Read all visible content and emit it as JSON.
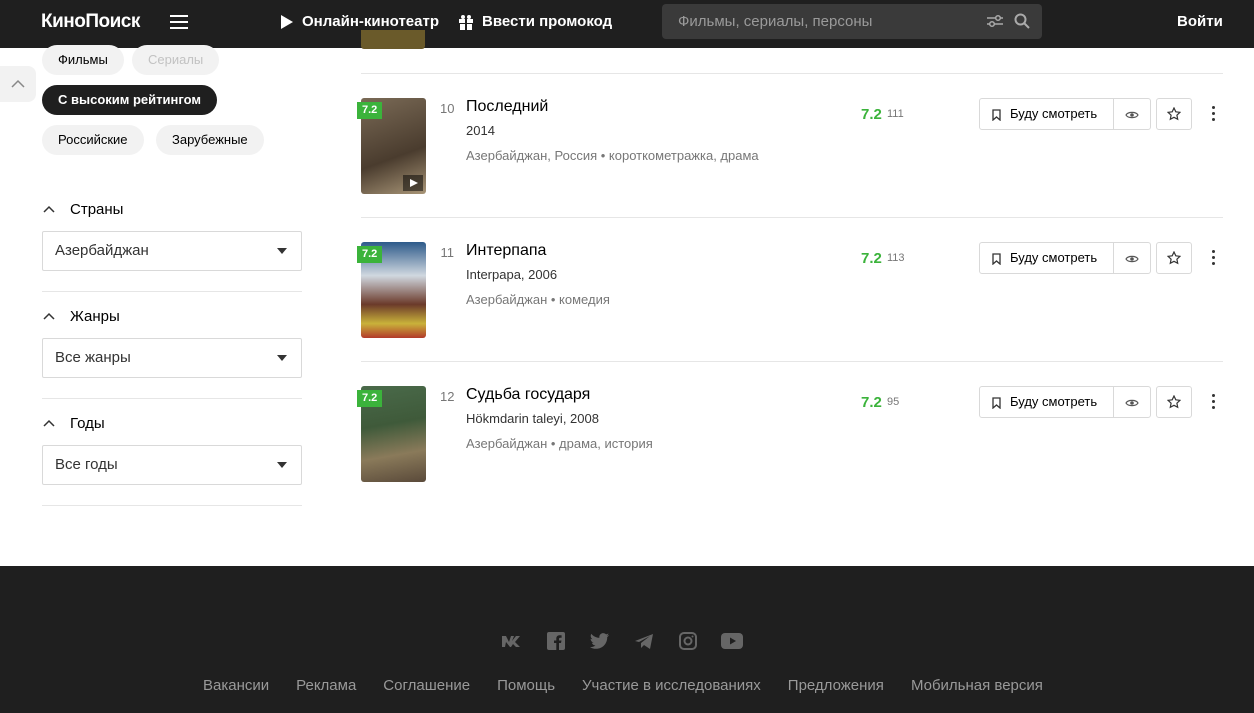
{
  "header": {
    "logo": "КиноПоиск",
    "online_cinema": "Онлайн-кинотеатр",
    "promo": "Ввести промокод",
    "search_placeholder": "Фильмы, сериалы, персоны",
    "login": "Войти"
  },
  "sidebar": {
    "chips": [
      "Фильмы",
      "Сериалы",
      "С высоким рейтингом",
      "Российские",
      "Зарубежные"
    ],
    "countries": {
      "title": "Страны",
      "value": "Азербайджан"
    },
    "genres": {
      "title": "Жанры",
      "value": "Все жанры"
    },
    "years": {
      "title": "Годы",
      "value": "Все годы"
    }
  },
  "items": [
    {
      "position": "10",
      "badge": "7.2",
      "title": "Последний",
      "subtitle": "2014",
      "meta": "Азербайджан, Россия • короткометражка, драма",
      "rating": "7.2",
      "votes": "111",
      "watch_label": "Буду смотреть",
      "poster_colors": [
        "#6b5a48",
        "#a89577"
      ]
    },
    {
      "position": "11",
      "badge": "7.2",
      "title": "Интерпапа",
      "subtitle": "Interpapa, 2006",
      "meta": "Азербайджан • комедия",
      "rating": "7.2",
      "votes": "113",
      "watch_label": "Буду смотреть",
      "poster_colors": [
        "#2d5a8a",
        "#c9b23a"
      ]
    },
    {
      "position": "12",
      "badge": "7.2",
      "title": "Судьба государя",
      "subtitle": "Hökmdarin taleyi, 2008",
      "meta": "Азербайджан • драма, история",
      "rating": "7.2",
      "votes": "95",
      "watch_label": "Буду смотреть",
      "poster_colors": [
        "#3f5a3a",
        "#8a7a5a"
      ]
    }
  ],
  "footer": {
    "social": [
      "vk-icon",
      "facebook-icon",
      "twitter-icon",
      "telegram-icon",
      "instagram-icon",
      "youtube-icon"
    ],
    "links": [
      "Вакансии",
      "Реклама",
      "Соглашение",
      "Помощь",
      "Участие в исследованиях",
      "Предложения",
      "Мобильная версия"
    ]
  },
  "colors": {
    "header_bg": "#1f1f1f",
    "rating_green": "#3bb33b",
    "chip_bg": "#f2f2f2"
  }
}
